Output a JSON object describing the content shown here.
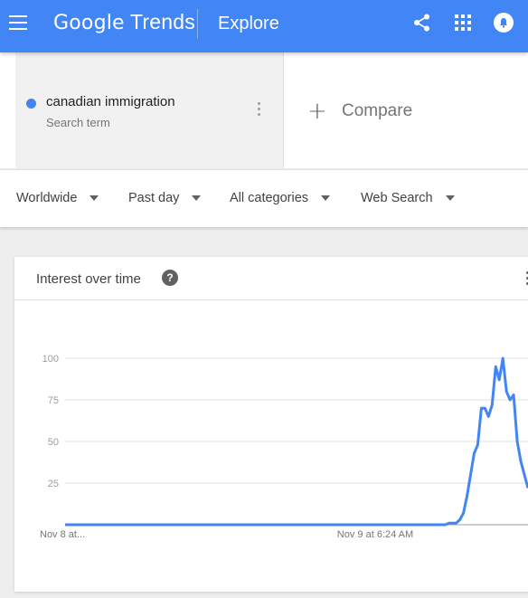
{
  "header": {
    "logo": {
      "google": "Google",
      "trends": "Trends"
    },
    "section": "Explore",
    "icons": [
      "menu-icon",
      "share-icon",
      "apps-icon",
      "notifications-icon"
    ]
  },
  "search_terms": [
    {
      "name": "canadian immigration",
      "type": "Search term",
      "color": "#4285f4"
    }
  ],
  "compare": {
    "plus": "+",
    "label": "Compare"
  },
  "filters": {
    "region": "Worldwide",
    "time": "Past day",
    "category": "All categories",
    "property": "Web Search"
  },
  "interest_card": {
    "title": "Interest over time",
    "help": "?"
  },
  "chart_data": {
    "type": "line",
    "title": "Interest over time",
    "ylim": [
      0,
      100
    ],
    "yticks": [
      25,
      50,
      75,
      100
    ],
    "grid": true,
    "xlabels": [
      "Nov 8 at...",
      "Nov 9 at 6:24 AM"
    ],
    "series": [
      {
        "name": "canadian immigration",
        "color": "#4285f4",
        "values": [
          0,
          0,
          0,
          0,
          0,
          0,
          0,
          0,
          0,
          0,
          0,
          0,
          0,
          0,
          0,
          0,
          0,
          0,
          0,
          0,
          0,
          0,
          0,
          0,
          0,
          0,
          0,
          0,
          0,
          0,
          0,
          0,
          0,
          0,
          0,
          0,
          0,
          0,
          0,
          0,
          0,
          0,
          0,
          0,
          0,
          0,
          0,
          0,
          0,
          0,
          0,
          0,
          0,
          0,
          0,
          0,
          0,
          0,
          0,
          0,
          0,
          0,
          0,
          0,
          0,
          0,
          0,
          0,
          0,
          0,
          0,
          0,
          0,
          0,
          0,
          0,
          0,
          0,
          0,
          0,
          0,
          0,
          0,
          0,
          0,
          0,
          0,
          0,
          0,
          0,
          0,
          0,
          0,
          0,
          0,
          0,
          0,
          0,
          0,
          0,
          0,
          0,
          0,
          0,
          0,
          0,
          0,
          1,
          1,
          1,
          3,
          7,
          17,
          30,
          43,
          48,
          70,
          70,
          65,
          72,
          95,
          87,
          100,
          80,
          75,
          78,
          50,
          38,
          30,
          22
        ]
      }
    ]
  }
}
